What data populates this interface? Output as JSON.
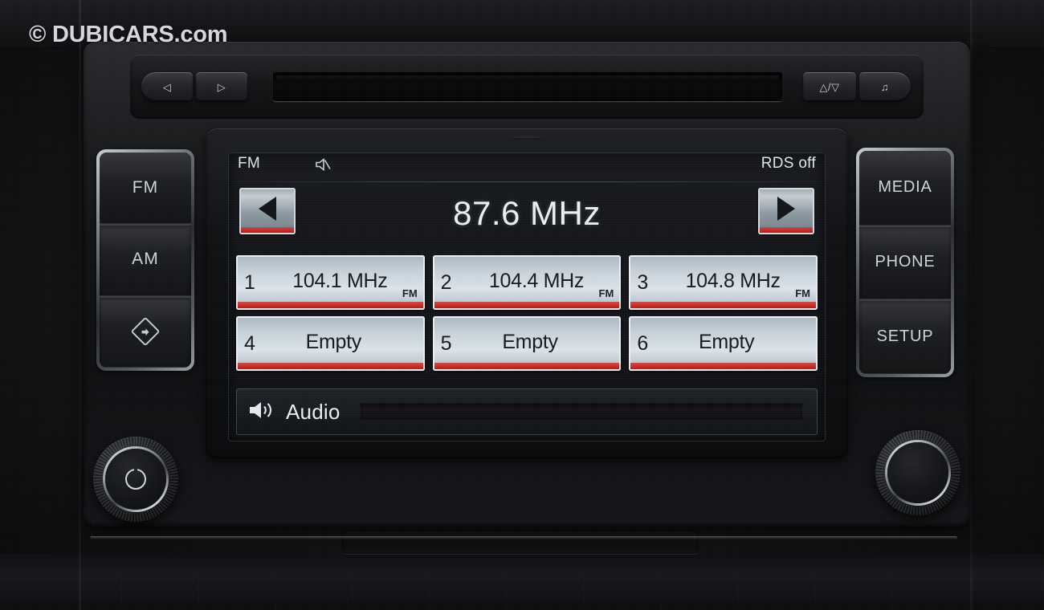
{
  "watermark": {
    "text": "© DUBICARS.com"
  },
  "device": {
    "name": "car-radio-head-unit"
  },
  "top_fascia": {
    "buttons": [
      {
        "name": "prev-track-button",
        "glyph": "◁"
      },
      {
        "name": "next-track-button",
        "glyph": "▷"
      },
      {
        "name": "eject-button",
        "glyph": "△/▽"
      },
      {
        "name": "media-note-button",
        "glyph": "♫"
      }
    ]
  },
  "left_cluster": {
    "buttons": [
      {
        "label": "FM",
        "name": "fm-button"
      },
      {
        "label": "AM",
        "name": "am-button"
      },
      {
        "label": "",
        "name": "traffic-program-button"
      }
    ]
  },
  "right_cluster": {
    "buttons": [
      {
        "label": "MEDIA",
        "name": "media-button"
      },
      {
        "label": "PHONE",
        "name": "phone-button"
      },
      {
        "label": "SETUP",
        "name": "setup-button"
      }
    ]
  },
  "screen": {
    "status": {
      "band": "FM",
      "mute_icon": "mute-icon",
      "rds": "RDS off"
    },
    "tuner": {
      "frequency": "87.6 MHz",
      "seek_down_label": "◀",
      "seek_up_label": "▶"
    },
    "presets": [
      {
        "number": "1",
        "label": "104.1 MHz",
        "band": "FM",
        "empty": false
      },
      {
        "number": "2",
        "label": "104.4 MHz",
        "band": "FM",
        "empty": false
      },
      {
        "number": "3",
        "label": "104.8 MHz",
        "band": "FM",
        "empty": false
      },
      {
        "number": "4",
        "label": "Empty",
        "band": "",
        "empty": true
      },
      {
        "number": "5",
        "label": "Empty",
        "band": "",
        "empty": true
      },
      {
        "number": "6",
        "label": "Empty",
        "band": "",
        "empty": true
      }
    ],
    "audio_bar": {
      "label": "Audio",
      "icon": "speaker-icon"
    }
  },
  "knobs": {
    "left": {
      "name": "power-volume-knob",
      "icon": "power-icon"
    },
    "right": {
      "name": "tune-select-knob",
      "icon": ""
    }
  },
  "colors": {
    "preset_accent": "#e2403a",
    "screen_text": "#e8edf2",
    "button_text": "#cfd3d9"
  }
}
